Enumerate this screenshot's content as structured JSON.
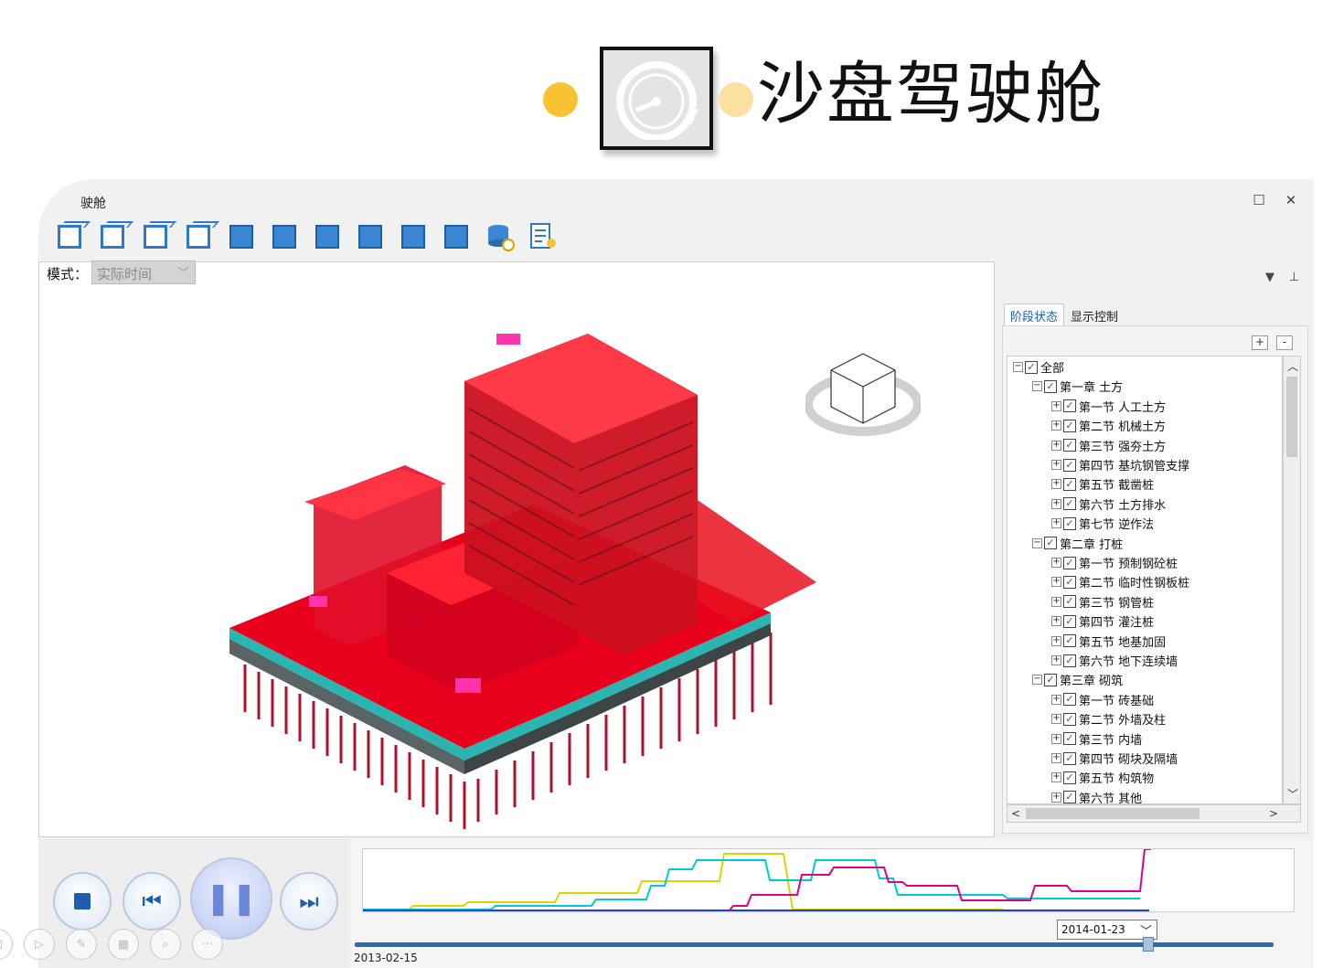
{
  "slide": {
    "title": "沙盘驾驶舱",
    "accent_colors": {
      "dot_primary": "#f9c232",
      "dot_secondary": "#fbe0a0"
    },
    "logo_icon": "gauge-icon"
  },
  "window": {
    "title": "驶舱",
    "controls": [
      "maximize-icon",
      "close-icon"
    ]
  },
  "toolbar": {
    "buttons": [
      "view-cube-1",
      "view-cube-2",
      "view-cube-3",
      "view-cube-4",
      "view-cube-5",
      "view-cube-6",
      "view-cube-7",
      "view-cube-8",
      "view-cube-9",
      "view-cube-10",
      "database-refresh-icon",
      "report-settings-icon"
    ]
  },
  "mode": {
    "label": "模式：",
    "selected": "实际时间"
  },
  "panel": {
    "tabs": [
      {
        "label": "阶段状态",
        "active": true
      },
      {
        "label": "显示控制",
        "active": false
      }
    ],
    "expand_all": "+",
    "collapse_all": "-",
    "tree": [
      {
        "level": 0,
        "label": "全部",
        "exp": "⊟"
      },
      {
        "level": 1,
        "label": "第一章  土方",
        "exp": "⊟"
      },
      {
        "level": 2,
        "label": "第一节  人工土方",
        "exp": "⊞"
      },
      {
        "level": 2,
        "label": "第二节  机械土方",
        "exp": "⊞"
      },
      {
        "level": 2,
        "label": "第三节  强夯土方",
        "exp": "⊞"
      },
      {
        "level": 2,
        "label": "第四节  基坑钢管支撑",
        "exp": "⊞"
      },
      {
        "level": 2,
        "label": "第五节  截凿桩",
        "exp": "⊞"
      },
      {
        "level": 2,
        "label": "第六节  土方排水",
        "exp": "⊞"
      },
      {
        "level": 2,
        "label": "第七节  逆作法",
        "exp": "⊞"
      },
      {
        "level": 1,
        "label": "第二章  打桩",
        "exp": "⊟"
      },
      {
        "level": 2,
        "label": "第一节  预制钢砼桩",
        "exp": "⊞"
      },
      {
        "level": 2,
        "label": "第二节  临时性钢板桩",
        "exp": "⊞"
      },
      {
        "level": 2,
        "label": "第三节  钢管桩",
        "exp": "⊞"
      },
      {
        "level": 2,
        "label": "第四节  灌注桩",
        "exp": "⊞"
      },
      {
        "level": 2,
        "label": "第五节  地基加固",
        "exp": "⊞"
      },
      {
        "level": 2,
        "label": "第六节  地下连续墙",
        "exp": "⊞"
      },
      {
        "level": 1,
        "label": "第三章  砌筑",
        "exp": "⊟"
      },
      {
        "level": 2,
        "label": "第一节  砖基础",
        "exp": "⊞"
      },
      {
        "level": 2,
        "label": "第二节  外墙及柱",
        "exp": "⊞"
      },
      {
        "level": 2,
        "label": "第三节  内墙",
        "exp": "⊞"
      },
      {
        "level": 2,
        "label": "第四节  砌块及隔墙",
        "exp": "⊞"
      },
      {
        "level": 2,
        "label": "第五节  构筑物",
        "exp": "⊞"
      },
      {
        "level": 2,
        "label": "第六节  其他",
        "exp": "⊞"
      }
    ]
  },
  "player": {
    "buttons": [
      "stop-icon",
      "rewind-icon",
      "pause-icon",
      "fast-forward-icon"
    ]
  },
  "timeline": {
    "start_date": "2013-02-15",
    "current_date": "2014-01-23",
    "series_colors": [
      "#d8d800",
      "#00c8d8",
      "#e0008a",
      "#1e3fd8"
    ]
  },
  "slide_controls": [
    "back-icon",
    "play-icon",
    "pen-icon",
    "grid-icon",
    "zoom-icon",
    "more-icon"
  ]
}
